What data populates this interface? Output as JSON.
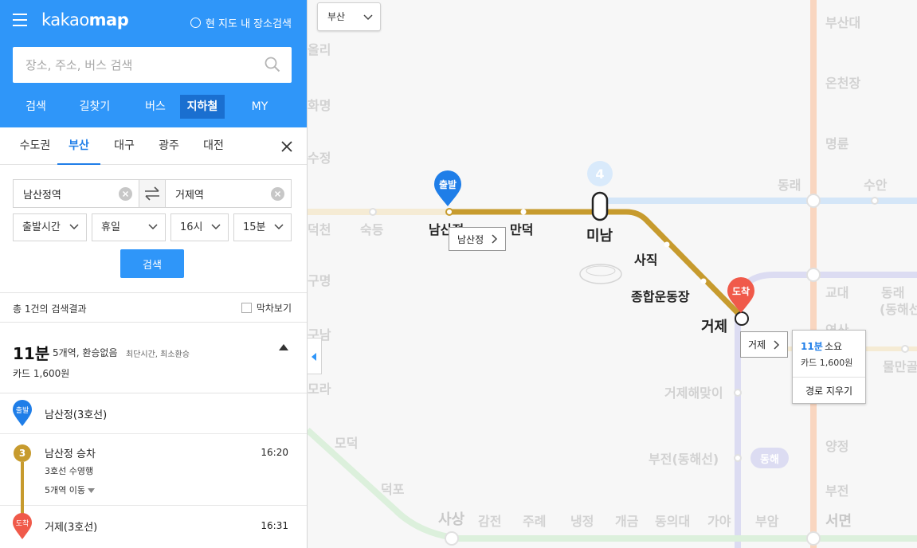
{
  "header": {
    "logo_light": "kakao",
    "logo_bold": "map",
    "map_search_toggle": "현 지도 내 장소검색",
    "search_placeholder": "장소, 주소, 버스 검색",
    "tabs": [
      {
        "label": "검색"
      },
      {
        "label": "길찾기"
      },
      {
        "label": "버스"
      },
      {
        "label": "지하철",
        "active": true
      },
      {
        "label": "MY"
      }
    ]
  },
  "region_tabs": [
    {
      "label": "수도권"
    },
    {
      "label": "부산",
      "active": true
    },
    {
      "label": "대구"
    },
    {
      "label": "광주"
    },
    {
      "label": "대전"
    }
  ],
  "route": {
    "origin": "남산정역",
    "destination": "거제역",
    "departure_type": "출발시간",
    "day_type": "휴일",
    "hour": "16시",
    "minute": "15분",
    "search_label": "검색"
  },
  "results": {
    "count_text": "총 1건의 검색결과",
    "last_train_label": "막차보기",
    "summary": {
      "time": "11분",
      "detail": "5개역, 환승없음",
      "note": "최단시간, 최소환승",
      "fare": "카드 1,600원"
    },
    "steps": {
      "start": {
        "pin": "출발",
        "label": "남산정(3호선)"
      },
      "board": {
        "line": "3",
        "label": "남산정 승차",
        "time": "16:20",
        "direction": "3호선 수영행",
        "stops": "5개역 이동"
      },
      "end": {
        "pin": "도착",
        "label": "거제(3호선)",
        "time": "16:31"
      }
    }
  },
  "map": {
    "region_select": "부산",
    "line4_badge": "4",
    "start_pin": "출발",
    "end_pin": "도착",
    "start_callout": "남산정",
    "end_callout": "거제",
    "route_info": {
      "time": "11분",
      "time_suffix": "소요",
      "fare": "카드 1,600원",
      "clear": "경로 지우기"
    },
    "active_stations": {
      "namsanjeong": "남산정",
      "mandeok": "만덕",
      "minam": "미남",
      "sajik": "사직",
      "sports_complex": "종합운동장",
      "geoje": "거제"
    },
    "faded_stations": {
      "busandae": "부산대",
      "oncheonjang": "온천장",
      "myeongnyun": "명륜",
      "dongnae": "동래",
      "suan": "수안",
      "gyodae": "교대",
      "dongnae_donghae": "동래",
      "dongnae_donghae_sub": "(동해선)",
      "yeonsan": "연산",
      "mulmangol": "물만골",
      "yangjeong": "양정",
      "bujeon": "부전",
      "seomyeon": "서면",
      "deokcheon": "덕천",
      "sukdeung": "숙등",
      "gupo_area1": "올리",
      "hwamyeong": "화명",
      "sujeong": "수정",
      "gumyeong": "구명",
      "gunam": "구남",
      "mora": "모라",
      "modeok": "모덕",
      "deokpo": "덕포",
      "sasang": "사상",
      "gamjeon": "감전",
      "jurye": "주례",
      "naengjeong": "냉정",
      "gaegeum": "개금",
      "dongeuidae": "동의대",
      "gaya": "가야",
      "buam": "부암",
      "geoje_haemaji": "거제해맞이",
      "bujeon_donghae": "부전(동해선)",
      "donghae_badge": "동해"
    }
  },
  "colors": {
    "header_blue": "#2f96f9",
    "active_tab": "#1a6fd0",
    "line3": "#c79b2e",
    "start_pin": "#1f7ee8",
    "end_pin": "#f05a4a"
  }
}
